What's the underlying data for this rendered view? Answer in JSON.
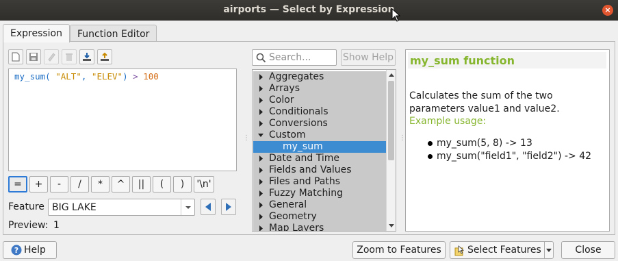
{
  "window": {
    "title": "airports — Select by Expression",
    "close": "×"
  },
  "tabs": [
    {
      "label": "Expression"
    },
    {
      "label": "Function Editor"
    }
  ],
  "toolbar": {
    "buttons": [
      "new-file-icon",
      "save-icon",
      "edit-icon",
      "delete-icon",
      "import-icon",
      "export-icon"
    ]
  },
  "expression": {
    "fn": "my_sum",
    "open": "( ",
    "arg1": "\"ALT\"",
    "comma": ", ",
    "arg2": "\"ELEV\"",
    "close": ")",
    "op": " > ",
    "num": "100"
  },
  "operators": [
    "=",
    "+",
    "-",
    "/",
    "*",
    "^",
    "||",
    "(",
    ")",
    "'\\n'"
  ],
  "feature": {
    "label": "Feature",
    "value": "BIG LAKE"
  },
  "preview": {
    "label": "Preview:",
    "value": "1"
  },
  "search": {
    "placeholder": "Search..."
  },
  "show_help": "Show Help",
  "tree": [
    {
      "label": "Aggregates",
      "expanded": false
    },
    {
      "label": "Arrays",
      "expanded": false
    },
    {
      "label": "Color",
      "expanded": false
    },
    {
      "label": "Conditionals",
      "expanded": false
    },
    {
      "label": "Conversions",
      "expanded": false
    },
    {
      "label": "Custom",
      "expanded": true
    },
    {
      "label": "my_sum",
      "child": true,
      "selected": true
    },
    {
      "label": "Date and Time",
      "expanded": false
    },
    {
      "label": "Fields and Values",
      "expanded": false
    },
    {
      "label": "Files and Paths",
      "expanded": false
    },
    {
      "label": "Fuzzy Matching",
      "expanded": false
    },
    {
      "label": "General",
      "expanded": false
    },
    {
      "label": "Geometry",
      "expanded": false
    },
    {
      "label": "Map Layers",
      "expanded": false
    }
  ],
  "help": {
    "title": "my_sum function",
    "description": "Calculates the sum of the two parameters value1 and value2.",
    "example_label": "Example usage:",
    "examples": [
      "my_sum(5, 8) -> 13",
      "my_sum(\"field1\", \"field2\") -> 42"
    ]
  },
  "buttons": {
    "help": "Help",
    "zoom": "Zoom to Features",
    "select": "Select Features",
    "close": "Close"
  },
  "colors": {
    "accent": "#86b52e",
    "selection": "#3d8bd1",
    "titlebar": "#3c3b37",
    "close": "#e2562f"
  }
}
